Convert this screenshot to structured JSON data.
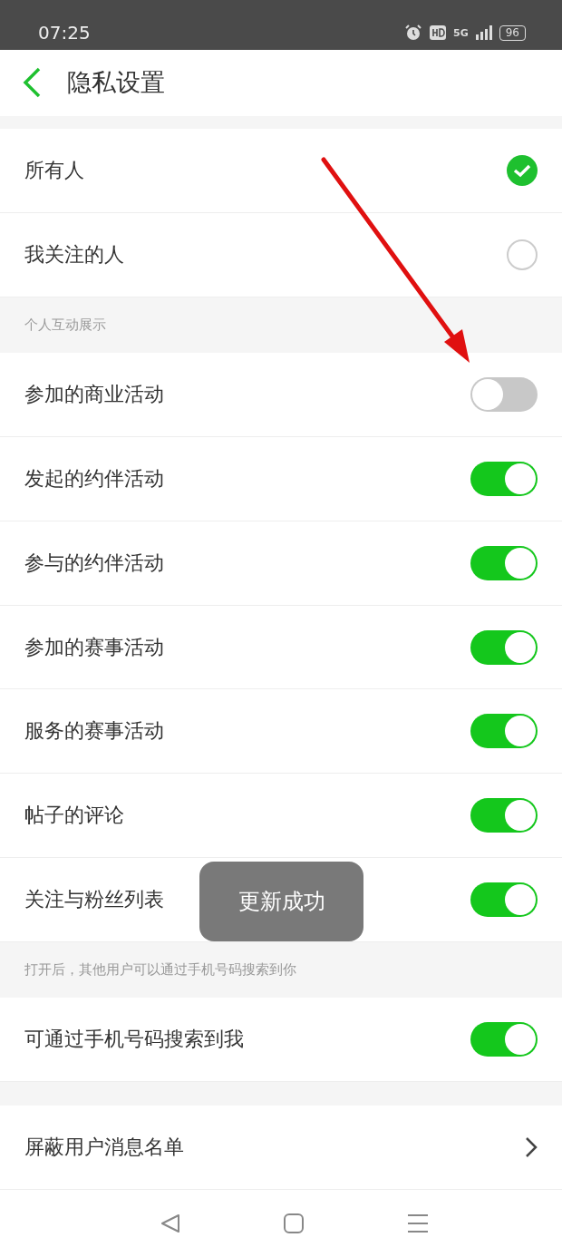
{
  "status_bar": {
    "time": "07:25",
    "network": "5G",
    "battery": "96"
  },
  "header": {
    "title": "隐私设置"
  },
  "visibility": [
    {
      "label": "所有人",
      "selected": true
    },
    {
      "label": "我关注的人",
      "selected": false
    }
  ],
  "interaction_section": {
    "title": "个人互动展示",
    "items": [
      {
        "label": "参加的商业活动",
        "on": false
      },
      {
        "label": "发起的约伴活动",
        "on": true
      },
      {
        "label": "参与的约伴活动",
        "on": true
      },
      {
        "label": "参加的赛事活动",
        "on": true
      },
      {
        "label": "服务的赛事活动",
        "on": true
      },
      {
        "label": "帖子的评论",
        "on": true
      },
      {
        "label": "关注与粉丝列表",
        "on": true
      }
    ]
  },
  "phone_section": {
    "hint": "打开后，其他用户可以通过手机号码搜索到你",
    "items": [
      {
        "label": "可通过手机号码搜索到我",
        "on": true
      }
    ]
  },
  "links": [
    {
      "label": "屏蔽用户消息名单"
    }
  ],
  "toast": "更新成功"
}
